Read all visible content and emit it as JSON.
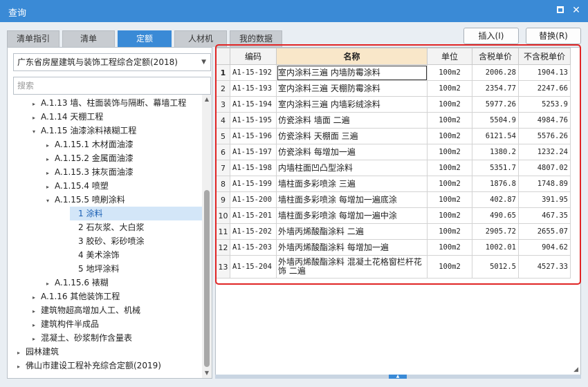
{
  "window": {
    "title": "查询"
  },
  "tabs": [
    {
      "label": "清单指引"
    },
    {
      "label": "清单"
    },
    {
      "label": "定额"
    },
    {
      "label": "人材机"
    },
    {
      "label": "我的数据"
    }
  ],
  "actions": {
    "insert": "插入(I)",
    "replace": "替换(R)"
  },
  "left": {
    "library": "广东省房屋建筑与装饰工程综合定额(2018)",
    "search_placeholder": "搜索",
    "tree": [
      {
        "label": "A.1.13 墙、柱面装饰与隔断、幕墙工程",
        "toggle": "▸"
      },
      {
        "label": "A.1.14 天棚工程",
        "toggle": "▸"
      },
      {
        "label": "A.1.15 油漆涂料裱糊工程",
        "toggle": "▾"
      },
      {
        "label": "A.1.15.1 木材面油漆",
        "toggle": "▸"
      },
      {
        "label": "A.1.15.2 金属面油漆",
        "toggle": "▸"
      },
      {
        "label": "A.1.15.3 抹灰面油漆",
        "toggle": "▸"
      },
      {
        "label": "A.1.15.4 喷塑",
        "toggle": "▸"
      },
      {
        "label": "A.1.15.5 喷刷涂料",
        "toggle": "▾"
      },
      {
        "label": "1 涂料",
        "toggle": ""
      },
      {
        "label": "2 石灰浆、大白浆",
        "toggle": ""
      },
      {
        "label": "3 胶砂、彩砂喷涂",
        "toggle": ""
      },
      {
        "label": "4 美术涂饰",
        "toggle": ""
      },
      {
        "label": "5 地坪涂料",
        "toggle": ""
      },
      {
        "label": "A.1.15.6 裱糊",
        "toggle": "▸"
      },
      {
        "label": "A.1.16 其他装饰工程",
        "toggle": "▸"
      },
      {
        "label": "建筑物超高增加人工、机械",
        "toggle": "▸"
      },
      {
        "label": "建筑构件半成品",
        "toggle": "▸"
      },
      {
        "label": "混凝土、砂浆制作含量表",
        "toggle": "▸"
      },
      {
        "label": "园林建筑",
        "toggle": "▸"
      },
      {
        "label": "佛山市建设工程补充综合定额(2019)",
        "toggle": "▸"
      }
    ]
  },
  "grid": {
    "headers": {
      "code": "编码",
      "name": "名称",
      "unit": "单位",
      "tax_price": "含税单价",
      "notax_price": "不含税单价"
    },
    "rows": [
      {
        "idx": "1",
        "code": "A1-15-192",
        "name": "室内涂料三遍 内墙防霉涂料",
        "unit": "100m2",
        "tax": "2006.28",
        "notax": "1904.13"
      },
      {
        "idx": "2",
        "code": "A1-15-193",
        "name": "室内涂料三遍 天棚防霉涂料",
        "unit": "100m2",
        "tax": "2354.77",
        "notax": "2247.66"
      },
      {
        "idx": "3",
        "code": "A1-15-194",
        "name": "室内涂料三遍 内墙彩绒涂料",
        "unit": "100m2",
        "tax": "5977.26",
        "notax": "5253.9"
      },
      {
        "idx": "4",
        "code": "A1-15-195",
        "name": "仿瓷涂料 墙面 二遍",
        "unit": "100m2",
        "tax": "5504.9",
        "notax": "4984.76"
      },
      {
        "idx": "5",
        "code": "A1-15-196",
        "name": "仿瓷涂料 天棚面 三遍",
        "unit": "100m2",
        "tax": "6121.54",
        "notax": "5576.26"
      },
      {
        "idx": "6",
        "code": "A1-15-197",
        "name": "仿瓷涂料 每增加一遍",
        "unit": "100m2",
        "tax": "1380.2",
        "notax": "1232.24"
      },
      {
        "idx": "7",
        "code": "A1-15-198",
        "name": "内墙柱面凹凸型涂料",
        "unit": "100m2",
        "tax": "5351.7",
        "notax": "4807.02"
      },
      {
        "idx": "8",
        "code": "A1-15-199",
        "name": "墙柱面多彩喷涂 三遍",
        "unit": "100m2",
        "tax": "1876.8",
        "notax": "1748.89"
      },
      {
        "idx": "9",
        "code": "A1-15-200",
        "name": "墙柱面多彩喷涂 每增加一遍底涂",
        "unit": "100m2",
        "tax": "402.87",
        "notax": "391.95"
      },
      {
        "idx": "10",
        "code": "A1-15-201",
        "name": "墙柱面多彩喷涂 每增加一遍中涂",
        "unit": "100m2",
        "tax": "490.65",
        "notax": "467.35"
      },
      {
        "idx": "11",
        "code": "A1-15-202",
        "name": "外墙丙烯酸酯涂料 二遍",
        "unit": "100m2",
        "tax": "2905.72",
        "notax": "2655.07"
      },
      {
        "idx": "12",
        "code": "A1-15-203",
        "name": "外墙丙烯酸酯涂料 每增加一遍",
        "unit": "100m2",
        "tax": "1002.01",
        "notax": "904.62"
      },
      {
        "idx": "13",
        "code": "A1-15-204",
        "name": "外墙丙烯酸酯涂料 混凝土花格窗栏杆花饰 二遍",
        "unit": "100m2",
        "tax": "5012.5",
        "notax": "4527.33"
      }
    ]
  }
}
